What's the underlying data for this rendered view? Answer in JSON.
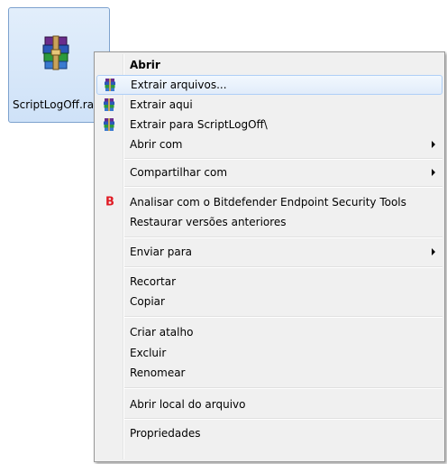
{
  "file": {
    "name": "ScriptLogOff.rar",
    "icon": "winrar-archive-icon"
  },
  "menu": {
    "items": [
      {
        "label": "Abrir",
        "bold": true
      },
      {
        "label": "Extrair arquivos...",
        "icon": "winrar-icon"
      },
      {
        "label": "Extrair aqui",
        "icon": "winrar-icon"
      },
      {
        "label": "Extrair para ScriptLogOff\\",
        "icon": "winrar-icon"
      },
      {
        "label": "Abrir com",
        "submenu": true
      },
      {
        "label": "Compartilhar com",
        "submenu": true
      },
      {
        "label": "Analisar com o Bitdefender Endpoint Security Tools",
        "icon": "bitdefender-icon",
        "icon_text": "B"
      },
      {
        "label": "Restaurar versões anteriores"
      },
      {
        "label": "Enviar para",
        "submenu": true
      },
      {
        "label": "Recortar"
      },
      {
        "label": "Copiar"
      },
      {
        "label": "Criar atalho"
      },
      {
        "label": "Excluir"
      },
      {
        "label": "Renomear"
      },
      {
        "label": "Abrir local do arquivo"
      },
      {
        "label": "Propriedades"
      }
    ]
  },
  "colors": {
    "bitdefender": "#e01b24",
    "selection_border": "#7da2ce",
    "highlight_border": "#aecff7"
  }
}
